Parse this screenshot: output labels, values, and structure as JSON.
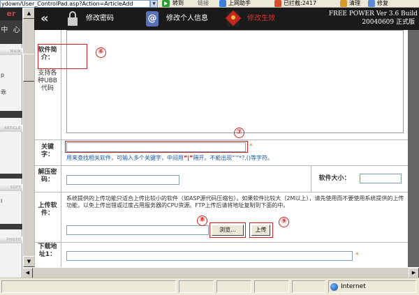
{
  "browser": {
    "address_value": "ydown/User_ControlPad.asp?Action=ArticleAdd",
    "go_label": "转到",
    "links_label": "链接",
    "helper_label": "上网助手",
    "blocked_label": "已拦截:2417",
    "clean_label": "清理",
    "repair_label": "修复"
  },
  "sidebar": {
    "logo": "er",
    "center_label": "中 心",
    "tabs": [
      "MAIN",
      "ARTICLE",
      "SOFT",
      "PHOTO"
    ],
    "items": [
      "p",
      "乖",
      "l"
    ]
  },
  "header": {
    "change_password": "修改密码",
    "edit_profile": "修改个人信息",
    "edit_info": "修改生效",
    "version_line1": "FREE POWER Ver 3.6 Build",
    "version_line2": "20040609 正式版"
  },
  "form": {
    "intro_label": "软件简介：",
    "intro_support": "支持各种UBB代码",
    "keyword_label": "关键字：",
    "keyword_hint_pre": "用来查找相关软件，可输入多个关键字，中间用",
    "keyword_hint_sep": "“|”",
    "keyword_hint_post": "隔开。不能出现\"'\"*?,()等字符。",
    "unzip_label": "解压密码：",
    "size_label": "软件大小：",
    "upload_label": "上传软件：",
    "upload_desc": "系统提供的上传功能只适合上传比较小的软件（如ASP源代码压缩包）。如果软件比较大（2M以上），请先使用而不要使用系统提供的上传功能，以免上传出错或过度占用服务器的CPU资源。FTP上传后请将地址复制到下面的中。",
    "browse_button": "浏览...",
    "upload_button": "上传",
    "download_label": "下载地址1：",
    "required_star": "*"
  },
  "annotations": {
    "n6": "⑥",
    "n7": "⑦",
    "n8": "⑧",
    "n9": "⑨"
  },
  "status": {
    "zone": "Internet"
  },
  "colors": {
    "header_bg": "#1a1a1a",
    "annotation": "#d42020",
    "hint_blue": "#1a5aa0",
    "hint_red": "#c00000"
  }
}
